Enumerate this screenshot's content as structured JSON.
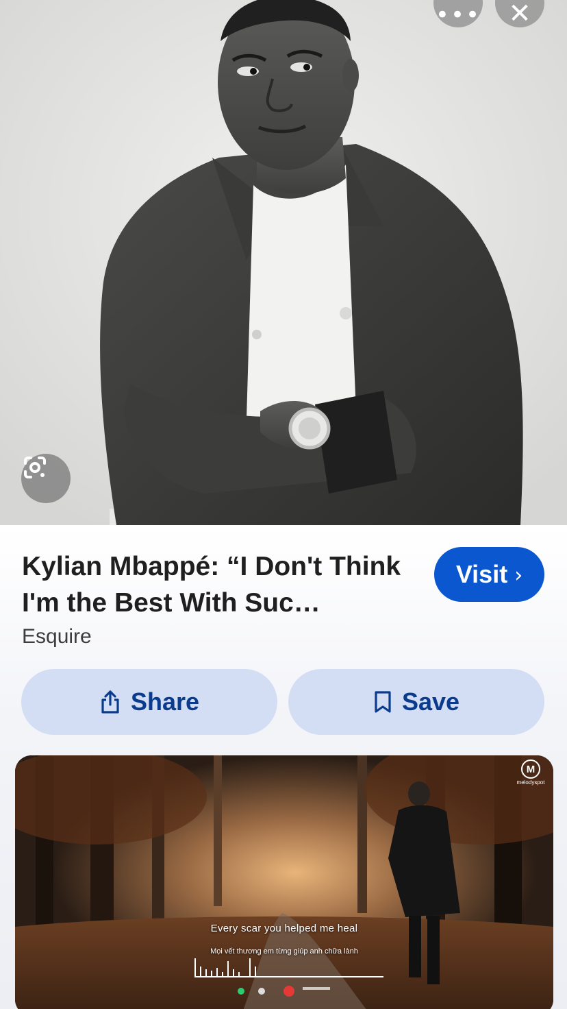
{
  "header": {
    "more_icon": "more-horizontal-icon",
    "close_icon": "close-icon"
  },
  "hero": {
    "lens_icon": "google-lens-icon"
  },
  "result": {
    "title": "Kylian Mbappé: “I Don't Think I'm the Best With Suc…",
    "source": "Esquire",
    "visit_label": "Visit",
    "visit_icon": "chevron-right-icon",
    "share_label": "Share",
    "share_icon": "share-icon",
    "save_label": "Save",
    "save_icon": "bookmark-icon"
  },
  "next_card": {
    "lyric_en": "Every scar you helped me heal",
    "lyric_vi": "Mọi vết thương em từng giúp anh chữa lành",
    "channel_logo_text": "melodyspot"
  },
  "colors": {
    "accent": "#0b57d0",
    "action_button_bg": "#d3def5",
    "action_text": "#0a3b8c"
  }
}
